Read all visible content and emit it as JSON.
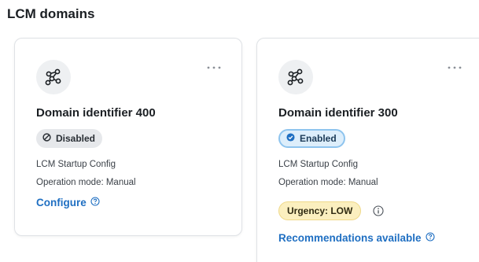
{
  "section_title": "LCM domains",
  "colors": {
    "link": "#1f6fc2",
    "badge_disabled_bg": "#e6e8eb",
    "badge_enabled_bg": "#ddeefb",
    "badge_enabled_border": "#8ec4ee",
    "urgency_low_bg": "#fbefbf"
  },
  "cards": [
    {
      "icon": "network-nodes-icon",
      "menu_icon": "more-horizontal-icon",
      "name": "Domain identifier 400",
      "status": {
        "label": "Disabled",
        "icon": "disabled-circle-icon"
      },
      "config": "LCM Startup Config",
      "operation_mode": "Operation mode: Manual",
      "link": {
        "label": "Configure",
        "icon": "help-circle-icon"
      }
    },
    {
      "icon": "network-nodes-icon",
      "menu_icon": "more-horizontal-icon",
      "name": "Domain identifier 300",
      "status": {
        "label": "Enabled",
        "icon": "check-circle-icon"
      },
      "config": "LCM Startup Config",
      "operation_mode": "Operation mode: Manual",
      "urgency": {
        "label": "Urgency: LOW",
        "icon": "info-circle-icon"
      },
      "link": {
        "label": "Recommendations available",
        "icon": "help-circle-icon"
      }
    }
  ]
}
